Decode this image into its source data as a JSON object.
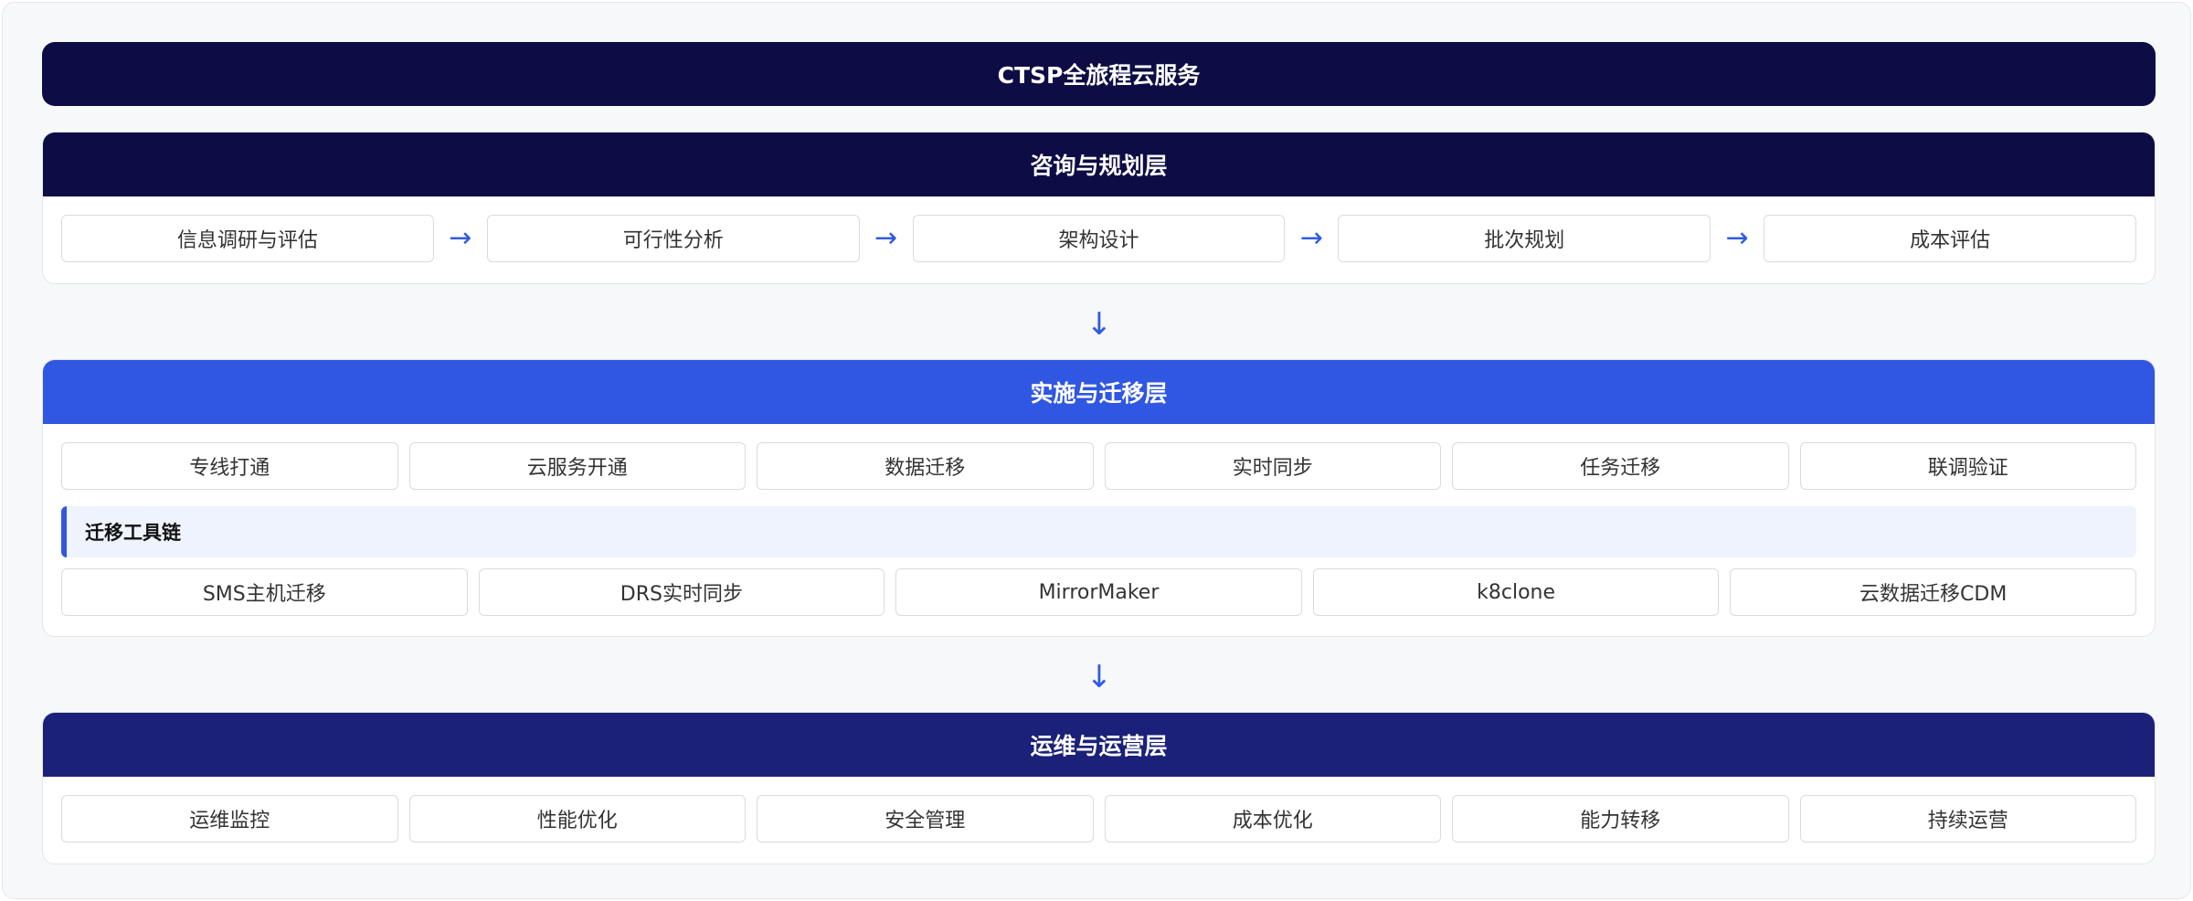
{
  "title": "CTSP全旅程云服务",
  "layers": {
    "consult": {
      "header": "咨询与规划层",
      "steps": [
        "信息调研与评估",
        "可行性分析",
        "架构设计",
        "批次规划",
        "成本评估"
      ]
    },
    "migrate": {
      "header": "实施与迁移层",
      "steps": [
        "专线打通",
        "云服务开通",
        "数据迁移",
        "实时同步",
        "任务迁移",
        "联调验证"
      ],
      "toolchain_label": "迁移工具链",
      "tools": [
        "SMS主机迁移",
        "DRS实时同步",
        "MirrorMaker",
        "k8clone",
        "云数据迁移CDM"
      ]
    },
    "operate": {
      "header": "运维与运营层",
      "steps": [
        "运维监控",
        "性能优化",
        "安全管理",
        "成本优化",
        "能力转移",
        "持续运营"
      ]
    }
  },
  "arrows": {
    "right": "→",
    "down": "↓"
  },
  "colors": {
    "navy": "#0e0c45",
    "blue": "#3057e1",
    "indigo": "#1b2078",
    "arrow": "#2f5be3",
    "toolchain_bg": "#eef3fd"
  }
}
